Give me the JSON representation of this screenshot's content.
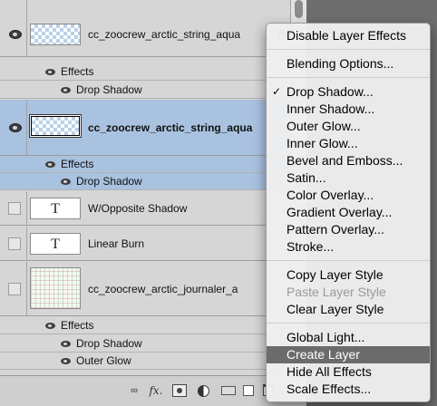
{
  "layers_panel": {
    "layers": [
      {
        "name": "cc_zoocrew_arctic_string_aqua",
        "visible": true,
        "selected": false,
        "thumb": "texture"
      },
      {
        "name": "cc_zoocrew_arctic_string_aqua",
        "visible": true,
        "selected": true,
        "thumb": "texture"
      },
      {
        "name": "W/Opposite Shadow",
        "visible": false,
        "thumb": "text",
        "thumb_glyph": "T"
      },
      {
        "name": "Linear Burn",
        "visible": false,
        "thumb": "text",
        "thumb_glyph": "T"
      },
      {
        "name": "cc_zoocrew_arctic_journaler_a",
        "visible": false,
        "thumb": "paper"
      }
    ],
    "effects_label": "Effects",
    "effects": {
      "layer1": [
        "Drop Shadow"
      ],
      "layer2": [
        "Drop Shadow"
      ],
      "layer5": [
        "Drop Shadow",
        "Outer Glow"
      ]
    },
    "fx_badge": "fx",
    "toolbar": {
      "link_icon": "link-icon",
      "fx_label": "fx."
    }
  },
  "context_menu": {
    "items": [
      {
        "label": "Disable Layer Effects"
      },
      {
        "label": "Blending Options..."
      },
      {
        "label": "Drop Shadow...",
        "checked": true
      },
      {
        "label": "Inner Shadow..."
      },
      {
        "label": "Outer Glow..."
      },
      {
        "label": "Inner Glow..."
      },
      {
        "label": "Bevel and Emboss..."
      },
      {
        "label": "Satin..."
      },
      {
        "label": "Color Overlay..."
      },
      {
        "label": "Gradient Overlay..."
      },
      {
        "label": "Pattern Overlay..."
      },
      {
        "label": "Stroke..."
      },
      {
        "label": "Copy Layer Style"
      },
      {
        "label": "Paste Layer Style",
        "disabled": true
      },
      {
        "label": "Clear Layer Style"
      },
      {
        "label": "Global Light..."
      },
      {
        "label": "Create Layer",
        "highlighted": true
      },
      {
        "label": "Hide All Effects"
      },
      {
        "label": "Scale Effects..."
      }
    ],
    "check_mark": "✓"
  },
  "colors": {
    "selected_row": "#a9c2df",
    "menu_highlight": "#6b6b6b"
  }
}
